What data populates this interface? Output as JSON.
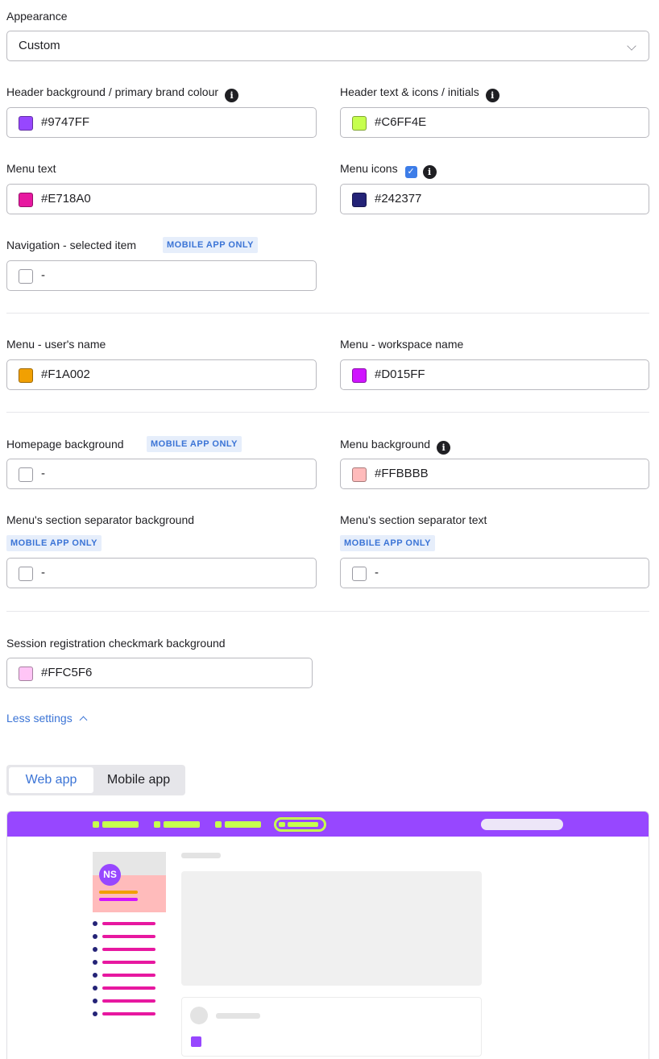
{
  "appearance": {
    "label": "Appearance",
    "value": "Custom"
  },
  "fields": {
    "header_bg": {
      "label": "Header background / primary brand colour",
      "value": "#9747FF",
      "color": "#9747FF"
    },
    "header_text": {
      "label": "Header text & icons / initials",
      "value": "#C6FF4E",
      "color": "#C6FF4E"
    },
    "menu_text": {
      "label": "Menu text",
      "value": "#E718A0",
      "color": "#E718A0"
    },
    "menu_icons": {
      "label": "Menu icons",
      "value": "#242377",
      "color": "#242377",
      "checked": true
    },
    "nav_selected": {
      "label": "Navigation - selected item",
      "badge": "MOBILE APP ONLY",
      "value": "-"
    },
    "menu_user_name": {
      "label": "Menu - user's name",
      "value": "#F1A002",
      "color": "#F1A002"
    },
    "menu_workspace_name": {
      "label": "Menu - workspace name",
      "value": "#D015FF",
      "color": "#D015FF"
    },
    "homepage_bg": {
      "label": "Homepage background",
      "badge": "MOBILE APP ONLY",
      "value": "-"
    },
    "menu_bg": {
      "label": "Menu background",
      "value": "#FFBBBB",
      "color": "#FFBBBB"
    },
    "menu_sep_bg": {
      "label": "Menu's section separator background",
      "badge": "MOBILE APP ONLY",
      "value": "-"
    },
    "menu_sep_text": {
      "label": "Menu's section separator text",
      "badge": "MOBILE APP ONLY",
      "value": "-"
    },
    "session_check_bg": {
      "label": "Session registration checkmark background",
      "value": "#FFC5F6",
      "color": "#FFC5F6"
    }
  },
  "less_settings": "Less settings",
  "tabs": [
    {
      "label": "Web app",
      "active": true
    },
    {
      "label": "Mobile app",
      "active": false
    }
  ],
  "preview": {
    "avatar_initials": "NS"
  },
  "colors": {
    "link": "#3B74D6",
    "badge_bg": "#E6EEFB",
    "preview_header": "#9747FF",
    "preview_header_items": "#C6FF4E",
    "preview_menu_bg": "#FFBBBB",
    "preview_menu_text": "#E718A0",
    "preview_menu_icons": "#242377",
    "preview_user_name": "#F1A002",
    "preview_workspace_name": "#D015FF",
    "preview_accent": "#9747FF"
  },
  "icons": {
    "info": "info-icon",
    "checkbox": "checkbox-checked-icon",
    "dropdown": "chevron-down-icon",
    "collapse": "chevron-up-icon"
  }
}
